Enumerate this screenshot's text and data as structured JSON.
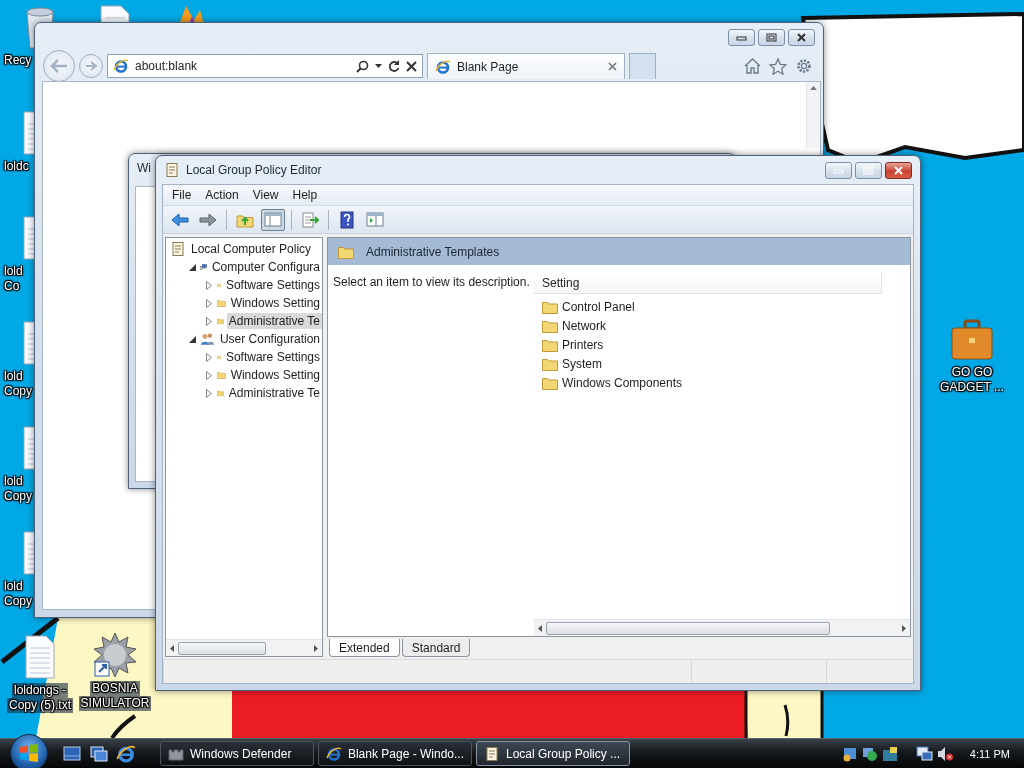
{
  "desktop_icons": [
    {
      "kind": "recycle",
      "lines": [
        "Recy"
      ]
    },
    {
      "kind": "document"
    },
    {
      "kind": "app"
    },
    {
      "kind": "document",
      "lines": [
        "loldc"
      ]
    },
    {
      "kind": "document",
      "lines": [
        "lold",
        "Co"
      ]
    },
    {
      "kind": "document",
      "lines": [
        "lold",
        "Copy"
      ]
    },
    {
      "kind": "document",
      "lines": [
        "lold",
        "Copy"
      ]
    },
    {
      "kind": "document",
      "lines": [
        "lold",
        "Copy"
      ]
    },
    {
      "kind": "document",
      "lines": [
        "loldongs -",
        "Copy (5).txt"
      ]
    },
    {
      "kind": "mine",
      "lines": [
        "BOSNIA",
        "SIMULATOR"
      ]
    },
    {
      "kind": "briefcase",
      "lines": [
        "GO GO",
        "GADGET ..."
      ]
    }
  ],
  "browser": {
    "address": "about:blank",
    "tab": {
      "title": "Blank Page"
    }
  },
  "background_window": {
    "title": "Wi"
  },
  "policy_editor": {
    "title": "Local Group Policy Editor",
    "menu": [
      "File",
      "Action",
      "View",
      "Help"
    ],
    "tree": [
      {
        "kind": "policy",
        "label": "Local Computer Policy",
        "selected": false,
        "children": [
          {
            "kind": "computer",
            "label": "Computer Configura",
            "expanded": true,
            "selected": false,
            "children": [
              {
                "kind": "folder",
                "label": "Software Settings",
                "expanded": false,
                "selected": false
              },
              {
                "kind": "folder",
                "label": "Windows Setting",
                "expanded": false,
                "selected": false
              },
              {
                "kind": "folder",
                "label": "Administrative Te",
                "expanded": false,
                "selected": true
              }
            ]
          },
          {
            "kind": "user",
            "label": "User Configuration",
            "expanded": true,
            "selected": false,
            "children": [
              {
                "kind": "folder",
                "label": "Software Settings",
                "expanded": false,
                "selected": false
              },
              {
                "kind": "folder",
                "label": "Windows Setting",
                "expanded": false,
                "selected": false
              },
              {
                "kind": "folder",
                "label": "Administrative Te",
                "expanded": false,
                "selected": false
              }
            ]
          }
        ]
      }
    ],
    "header": "Administrative Templates",
    "description": "Select an item to view its description.",
    "list": {
      "column": "Setting",
      "items": [
        "Control Panel",
        "Network",
        "Printers",
        "System",
        "Windows Components"
      ]
    },
    "view_tabs": [
      {
        "label": "Extended",
        "selected": true
      },
      {
        "label": "Standard",
        "selected": false
      }
    ]
  },
  "taskbar": {
    "tasks": [
      {
        "kind": "defender",
        "label": "Windows Defender",
        "selected": false
      },
      {
        "kind": "browser",
        "label": "Blank Page - Windo...",
        "selected": false
      },
      {
        "kind": "policy",
        "label": "Local Group Policy ...",
        "selected": true
      }
    ],
    "clock": "4:11 PM"
  }
}
